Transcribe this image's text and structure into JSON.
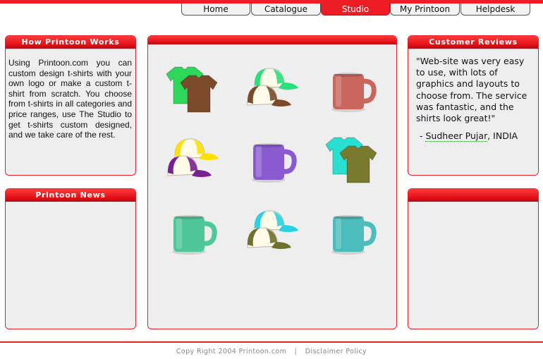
{
  "nav": {
    "tabs": [
      {
        "label": "Home"
      },
      {
        "label": "Catalogue"
      },
      {
        "label": "Studio"
      },
      {
        "label": "My Printoon"
      },
      {
        "label": "Helpdesk"
      }
    ],
    "active_tab": "Studio"
  },
  "how_panel": {
    "title": "How Printoon Works",
    "body": "Using Printoon.com you can custom design t-shirts with your own logo or make a custom t-shirt from scratch. You choose from t-shirts in all categories and price ranges, use The Studio to get t-shirts custom designed, and we take care of the rest."
  },
  "news_panel": {
    "title": "Printoon News"
  },
  "reviews_panel": {
    "title": "Customer Reviews",
    "quote": "\"Web-site was very easy to use, with lots of graphics and layouts to choose from. The service was fantastic, and the shirts look great!\"",
    "author_prefix": "- ",
    "author_name": "Sudheer Pujar",
    "author_suffix": ", INDIA"
  },
  "products": [
    {
      "type": "tshirts",
      "colors": [
        "#2ed65a",
        "#7b4a2a"
      ]
    },
    {
      "type": "caps",
      "colors": [
        "#29e07a",
        "#7a4a2a"
      ]
    },
    {
      "type": "mug",
      "colors": [
        "#c9665e"
      ]
    },
    {
      "type": "caps",
      "colors": [
        "#ffe000",
        "#7a1f90"
      ]
    },
    {
      "type": "mug",
      "colors": [
        "#8a5ad0"
      ]
    },
    {
      "type": "tshirts",
      "colors": [
        "#29e0d0",
        "#7a7a2e"
      ]
    },
    {
      "type": "mug",
      "colors": [
        "#4fc79a"
      ]
    },
    {
      "type": "caps",
      "colors": [
        "#29d2e0",
        "#6f6f2e"
      ]
    },
    {
      "type": "mug",
      "colors": [
        "#4cbcbc"
      ]
    }
  ],
  "footer": {
    "copyright": "Copy Right 2004 Printoon.com",
    "separator": "|",
    "disclaimer": "Disclaimer Policy"
  },
  "colors": {
    "accent": "#ee1c24",
    "panel_bg": "#eeeeee"
  }
}
